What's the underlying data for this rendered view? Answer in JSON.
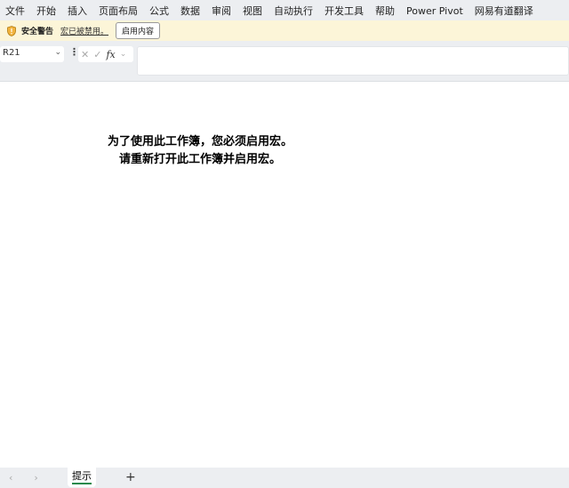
{
  "menu": [
    "文件",
    "开始",
    "插入",
    "页面布局",
    "公式",
    "数据",
    "审阅",
    "视图",
    "自动执行",
    "开发工具",
    "帮助",
    "Power Pivot",
    "网易有道翻译"
  ],
  "warning": {
    "title": "安全警告",
    "message": "宏已被禁用。",
    "button": "启用内容",
    "color": "#fcf5d8"
  },
  "formula_bar": {
    "name_box": "R21",
    "fx": "fx",
    "value": ""
  },
  "message": {
    "line1": "为了使用此工作簿，您必须启用宏。",
    "line2": "请重新打开此工作簿并启用宏。"
  },
  "sheets": {
    "tabs": [
      "提示"
    ],
    "active": "提示",
    "add": "+",
    "prev": "‹",
    "next": "›"
  },
  "colors": {
    "accent": "#1f8a4c"
  }
}
